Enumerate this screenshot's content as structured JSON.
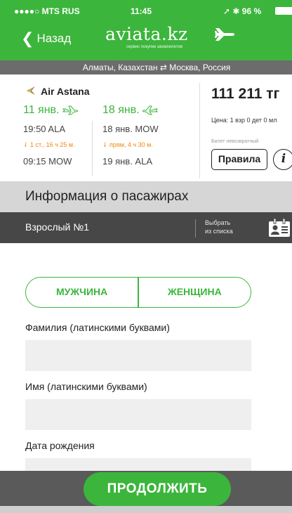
{
  "status_bar": {
    "carrier": "●●●●○ MTS RUS",
    "time": "11:45",
    "battery": "96 %"
  },
  "header": {
    "back_label": "Назад",
    "logo_text": "aviata.kz",
    "logo_subtitle": "сервис покупки авиабилетов",
    "route": "Алматы, Казахстан ⇄ Москва, Россия"
  },
  "flight": {
    "airline": "Air Astana",
    "outbound": {
      "date": "11 янв.",
      "depart": "19:50 ALA",
      "info": "1 ст., 16 ч 25 м.",
      "arrive": "09:15 MOW"
    },
    "return": {
      "date": "18 янв.",
      "depart": "18 янв. MOW",
      "info": "прям, 4 ч 30 м.",
      "arrive": "19 янв. ALA"
    },
    "price": "111 211 тг",
    "price_detail": "Цена: 1 взр 0 дет 0 мл",
    "nonrefundable": "Билет невозвратный",
    "rules_label": "Правила",
    "info_label": "i"
  },
  "passengers": {
    "section_title": "Информация о пасажирах",
    "adult_label": "Взрослый №1",
    "choose_line1": "Выбрать",
    "choose_line2": "из списка",
    "gender_male": "МУЖЧИНА",
    "gender_female": "ЖЕНЩИНА",
    "surname_label": "Фамилия (латинскими буквами)",
    "surname_value": "",
    "name_label": "Имя (латинскими буквами)",
    "name_value": "",
    "birth_label": "Дата рождения",
    "birth_value": ""
  },
  "footer": {
    "continue_label": "ПРОДОЛЖИТЬ"
  },
  "colors": {
    "brand_green": "#3cb53c",
    "accent_orange": "#f0860e",
    "dark_bar": "#474747"
  }
}
